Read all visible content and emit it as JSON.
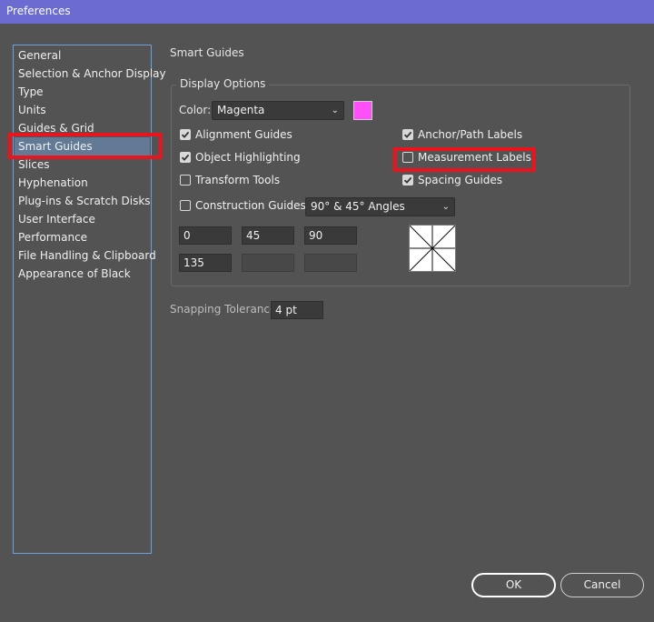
{
  "window": {
    "title": "Preferences"
  },
  "sidebar": {
    "items": [
      {
        "label": "General"
      },
      {
        "label": "Selection & Anchor Display"
      },
      {
        "label": "Type"
      },
      {
        "label": "Units"
      },
      {
        "label": "Guides & Grid"
      },
      {
        "label": "Smart Guides",
        "selected": true
      },
      {
        "label": "Slices"
      },
      {
        "label": "Hyphenation"
      },
      {
        "label": "Plug-ins & Scratch Disks"
      },
      {
        "label": "User Interface"
      },
      {
        "label": "Performance"
      },
      {
        "label": "File Handling & Clipboard"
      },
      {
        "label": "Appearance of Black"
      }
    ]
  },
  "main": {
    "section_title": "Smart Guides",
    "display_options": {
      "group_label": "Display Options",
      "color_label": "Color:",
      "color_value": "Magenta",
      "swatch_color": "#ff4ff8",
      "checkboxes": {
        "alignment_guides": {
          "label": "Alignment Guides",
          "checked": true
        },
        "object_highlighting": {
          "label": "Object Highlighting",
          "checked": true
        },
        "transform_tools": {
          "label": "Transform Tools",
          "checked": false
        },
        "anchor_path_labels": {
          "label": "Anchor/Path Labels",
          "checked": true
        },
        "measurement_labels": {
          "label": "Measurement Labels",
          "checked": false
        },
        "spacing_guides": {
          "label": "Spacing Guides",
          "checked": true
        },
        "construction_guides": {
          "label": "Construction Guides:",
          "checked": false
        }
      },
      "angles_preset": "90° & 45° Angles",
      "angle_fields": [
        "0",
        "45",
        "90",
        "135",
        "",
        ""
      ]
    },
    "snapping": {
      "label": "Snapping Tolerance:",
      "value": "4 pt"
    }
  },
  "buttons": {
    "ok": "OK",
    "cancel": "Cancel"
  },
  "colors": {
    "highlight": "#e8141e",
    "titlebar": "#6b6bd2",
    "selected_item": "#627a96"
  }
}
